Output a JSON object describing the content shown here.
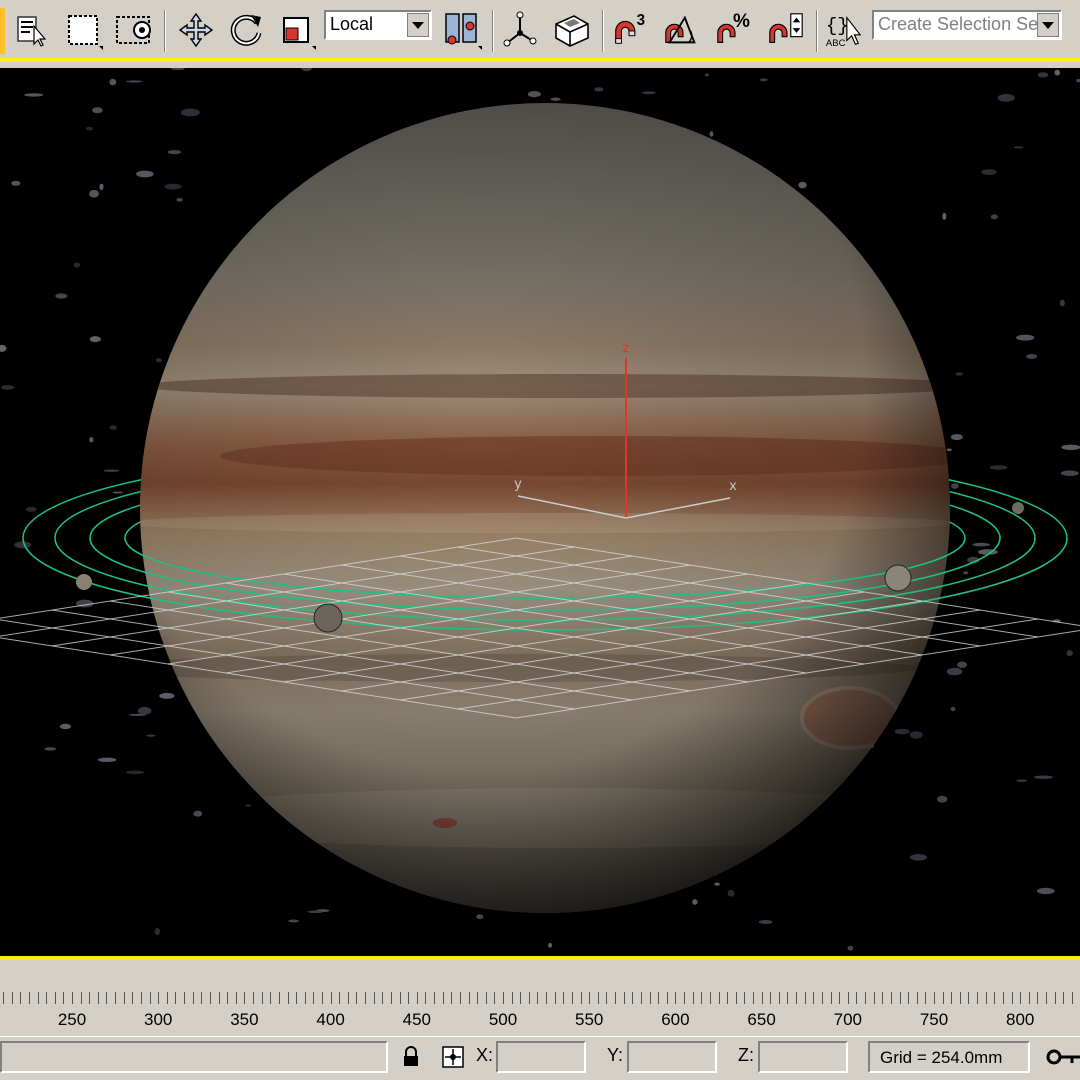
{
  "toolbar": {
    "reference_coord_system": "Local",
    "selection_set_placeholder": "Create Selection Set",
    "buttons": {
      "select_by_name": "select-by-name",
      "rect_region": "rectangular-selection-region",
      "window_crossing": "window-crossing-toggle",
      "move": "move",
      "rotate": "rotate",
      "scale": "scale",
      "pivot": "use-pivot-point",
      "manipulate": "select-and-manipulate",
      "keyboard_shortcut": "keyboard-shortcut-override",
      "snap_3d": "3D",
      "angle_snap": "angle-snap",
      "percent_snap": "%",
      "spinner_snap": "spinner-snap",
      "named_sets": "ABC"
    }
  },
  "viewport": {
    "gizmo_axes": {
      "z": "z",
      "y": "y",
      "x": "x"
    },
    "colors": {
      "axis_z": "#e0352b",
      "axis_xy": "#cccccc",
      "orbit": "#1fbf84",
      "grid": "#d8d8d8",
      "background": "#000000"
    }
  },
  "ruler": {
    "labels": [
      "250",
      "300",
      "350",
      "400",
      "450",
      "500",
      "550",
      "600",
      "650",
      "700",
      "750",
      "800"
    ]
  },
  "status": {
    "x_label": "X:",
    "y_label": "Y:",
    "z_label": "Z:",
    "x_value": "",
    "y_value": "",
    "z_value": "",
    "grid": "Grid = 254.0mm"
  },
  "colors": {
    "ui_face": "#d4d0c8",
    "active_border": "#ffef17"
  }
}
